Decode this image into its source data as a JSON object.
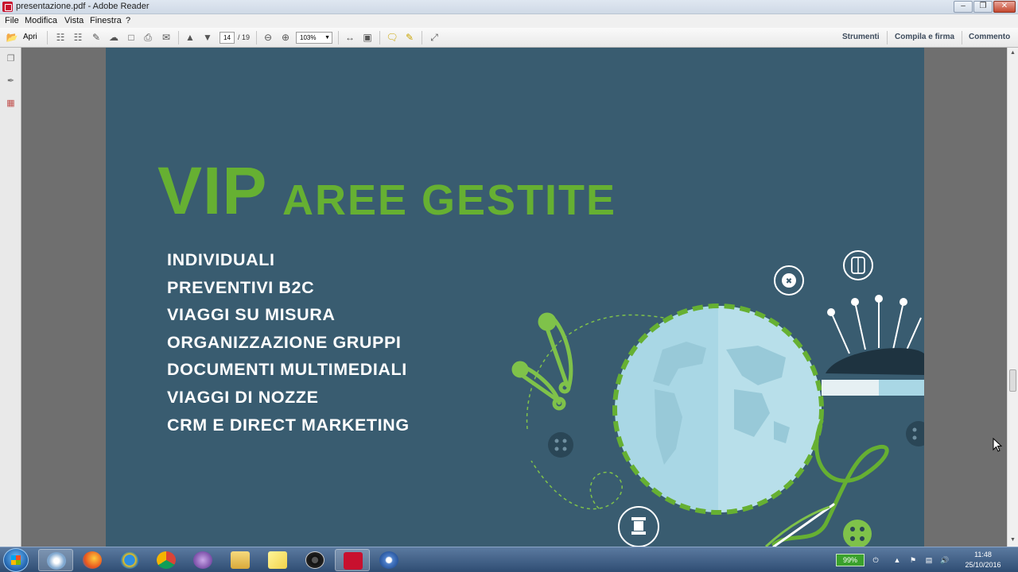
{
  "window": {
    "title": "presentazione.pdf - Adobe Reader",
    "buttons": {
      "minimize": "–",
      "maximize": "❐",
      "close": "✕"
    }
  },
  "menu": [
    "File",
    "Modifica",
    "Vista",
    "Finestra",
    "?"
  ],
  "toolbar": {
    "open_label": "Apri",
    "page_current": "14",
    "page_total": "/ 19",
    "zoom": "103%",
    "right_links": [
      "Strumenti",
      "Compila e firma",
      "Commento"
    ]
  },
  "slide": {
    "vip": "VIP",
    "heading": "AREE GESTITE",
    "areas": [
      "INDIVIDUALI",
      "PREVENTIVI B2C",
      "VIAGGI SU MISURA",
      "ORGANIZZAZIONE GRUPPI",
      "DOCUMENTI MULTIMEDIALI",
      "VIAGGI DI NOZZE",
      "CRM E DIRECT MARKETING"
    ],
    "colors": {
      "background": "#395c70",
      "accent": "#66b032",
      "text": "#ffffff"
    }
  },
  "taskbar": {
    "apps": [
      "start-icon",
      "explorer-icon",
      "firefox-icon",
      "ie-icon",
      "chrome-icon",
      "app-icon",
      "folder-icon",
      "notes-icon",
      "obs-icon",
      "acrobat-icon",
      "settings-icon"
    ],
    "battery": "99%",
    "time": "11:48",
    "date": "25/10/2016"
  }
}
